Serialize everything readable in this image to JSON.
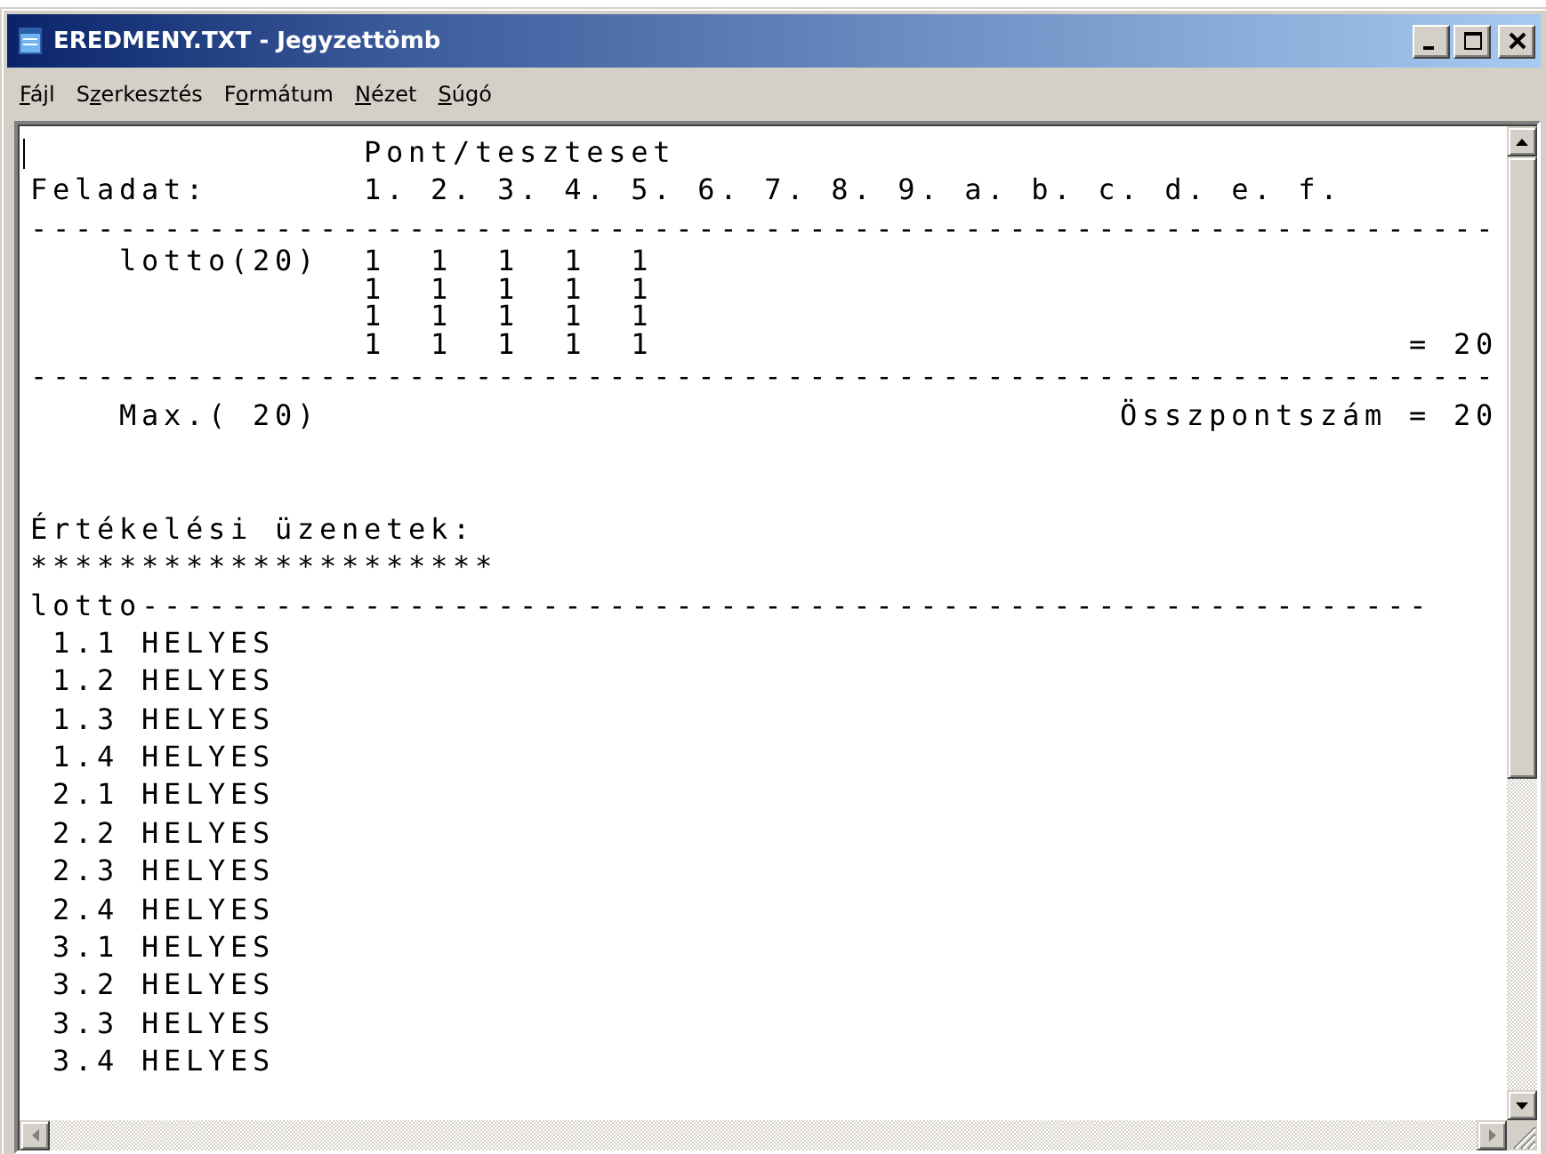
{
  "window": {
    "title": "EREDMENY.TXT - Jegyzettömb"
  },
  "menu": [
    {
      "key": "F",
      "after": "ájl"
    },
    {
      "before": "S",
      "key": "z",
      "after": "erkesztés"
    },
    {
      "before": "F",
      "key": "o",
      "after": "rmátum"
    },
    {
      "key": "N",
      "after": "ézet"
    },
    {
      "key": "S",
      "after": "úgó"
    }
  ],
  "document": {
    "lines": [
      {
        "kind": "text",
        "text": "               Pont/teszteset"
      },
      {
        "kind": "text",
        "text": "Feladat:       1. 2. 3. 4. 5. 6. 7. 8. 9. a. b. c. d. e. f."
      },
      {
        "kind": "rule",
        "text": "------------------------------------------------------------------"
      },
      {
        "kind": "score",
        "text": "    lotto(20)  1  1  1  1  1"
      },
      {
        "kind": "score",
        "text": "               1  1  1  1  1"
      },
      {
        "kind": "score",
        "text": "               1  1  1  1  1"
      },
      {
        "kind": "score",
        "text": "               1  1  1  1  1",
        "total": "= 20"
      },
      {
        "kind": "rule",
        "text": "------------------------------------------------------------------"
      },
      {
        "kind": "text",
        "text": "    Max.( 20)",
        "total": "Összpontszám = 20"
      },
      {
        "kind": "blank"
      },
      {
        "kind": "blank"
      },
      {
        "kind": "text",
        "text": "Értékelési üzenetek:"
      },
      {
        "kind": "text",
        "text": "*********************"
      },
      {
        "kind": "text",
        "text": "lotto----------------------------------------------------------"
      },
      {
        "kind": "text",
        "text": " 1.1 HELYES"
      },
      {
        "kind": "text",
        "text": " 1.2 HELYES"
      },
      {
        "kind": "text",
        "text": " 1.3 HELYES"
      },
      {
        "kind": "text",
        "text": " 1.4 HELYES"
      },
      {
        "kind": "text",
        "text": " 2.1 HELYES"
      },
      {
        "kind": "text",
        "text": " 2.2 HELYES"
      },
      {
        "kind": "text",
        "text": " 2.3 HELYES"
      },
      {
        "kind": "text",
        "text": " 2.4 HELYES"
      },
      {
        "kind": "text",
        "text": " 3.1 HELYES"
      },
      {
        "kind": "text",
        "text": " 3.2 HELYES"
      },
      {
        "kind": "text",
        "text": " 3.3 HELYES"
      },
      {
        "kind": "text",
        "text": " 3.4 HELYES"
      }
    ]
  }
}
